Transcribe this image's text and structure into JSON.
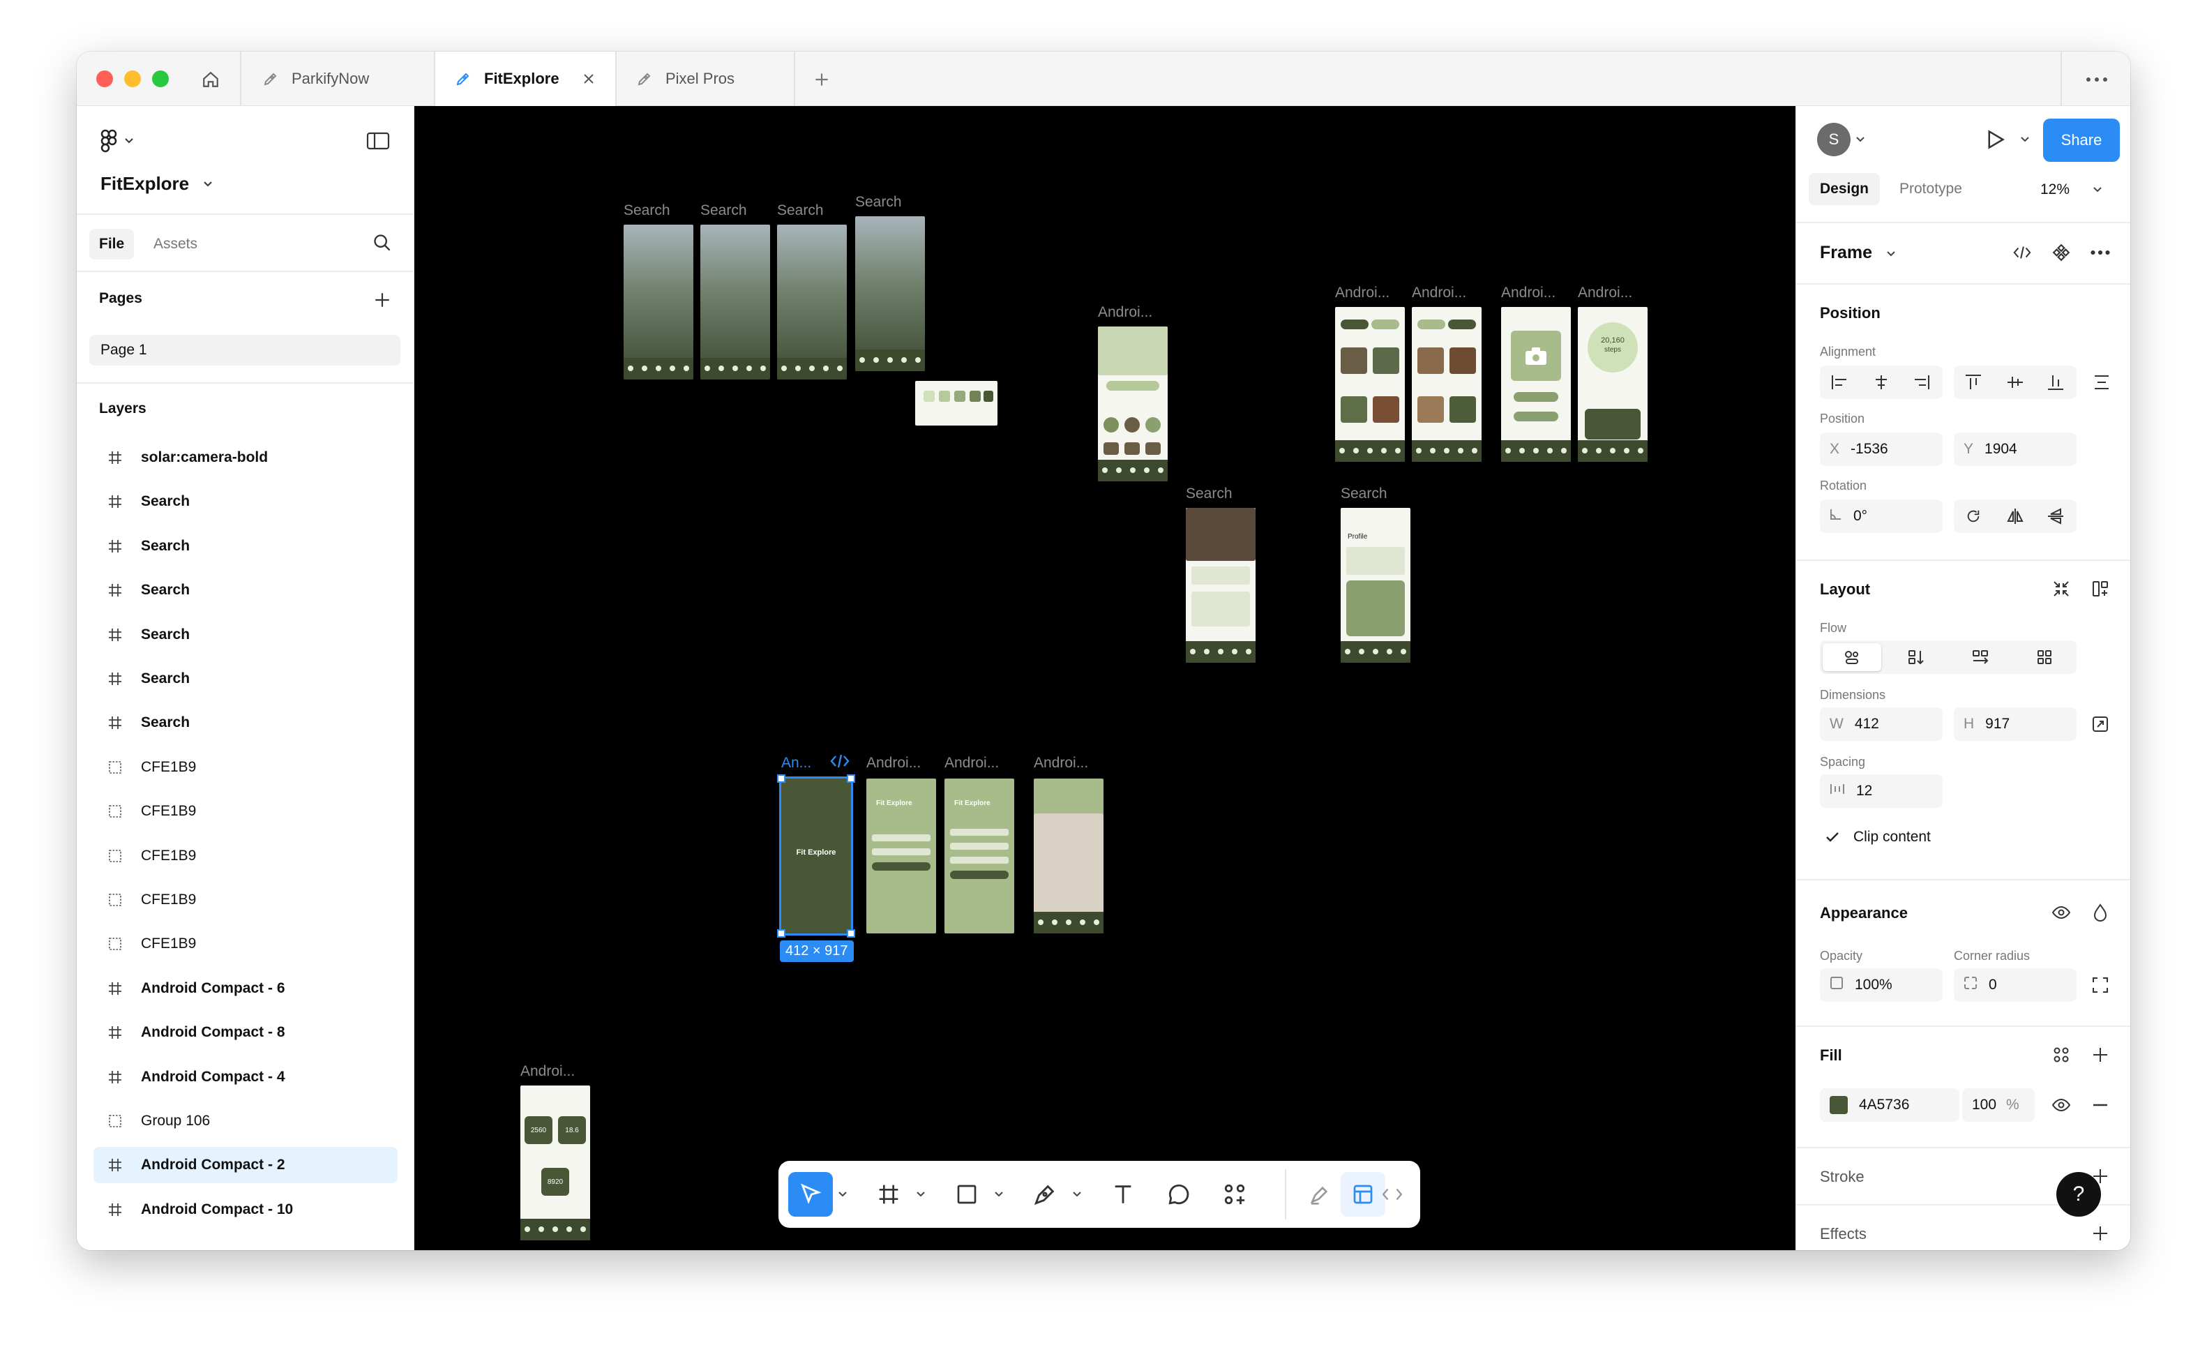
{
  "tabs": [
    {
      "label": "ParkifyNow"
    },
    {
      "label": "FitExplore"
    },
    {
      "label": "Pixel Pros"
    }
  ],
  "file": {
    "name": "FitExplore"
  },
  "left_tabs": {
    "file": "File",
    "assets": "Assets"
  },
  "pages": {
    "title": "Pages",
    "items": [
      "Page 1"
    ]
  },
  "layers": {
    "title": "Layers",
    "items": [
      {
        "label": "solar:camera-bold",
        "icon": "frame-icon"
      },
      {
        "label": "Search",
        "icon": "frame-icon"
      },
      {
        "label": "Search",
        "icon": "frame-icon"
      },
      {
        "label": "Search",
        "icon": "frame-icon"
      },
      {
        "label": "Search",
        "icon": "frame-icon"
      },
      {
        "label": "Search",
        "icon": "frame-icon"
      },
      {
        "label": "Search",
        "icon": "frame-icon"
      },
      {
        "label": "CFE1B9",
        "icon": "group-icon"
      },
      {
        "label": "CFE1B9",
        "icon": "group-icon"
      },
      {
        "label": "CFE1B9",
        "icon": "group-icon"
      },
      {
        "label": "CFE1B9",
        "icon": "group-icon"
      },
      {
        "label": "CFE1B9",
        "icon": "group-icon"
      },
      {
        "label": "Android Compact - 6",
        "icon": "frame-icon"
      },
      {
        "label": "Android Compact - 8",
        "icon": "frame-icon"
      },
      {
        "label": "Android Compact - 4",
        "icon": "frame-icon"
      },
      {
        "label": "Group 106",
        "icon": "group-icon"
      },
      {
        "label": "Android Compact - 2",
        "icon": "frame-icon",
        "selected": true
      },
      {
        "label": "Android Compact - 10",
        "icon": "frame-icon"
      }
    ]
  },
  "canvas": {
    "frame_labels": [
      "Search",
      "Search",
      "Search",
      "Search",
      "Androi...",
      "Androi...",
      "Androi...",
      "Androi...",
      "Androi...",
      "Search",
      "Search",
      "An...",
      "Androi...",
      "Androi...",
      "Androi...",
      "Androi..."
    ],
    "selection_size": "412 × 917",
    "mock_text": {
      "fit_explore": "Fit Explore",
      "steps": "20,160",
      "steps_unit": "steps",
      "profile": "Profile",
      "stat_a": "2560",
      "stat_b": "18.6",
      "stat_c": "8920"
    }
  },
  "right": {
    "avatar_initial": "S",
    "share_label": "Share",
    "tab_design": "Design",
    "tab_prototype": "Prototype",
    "zoom": "12%",
    "frame_title": "Frame",
    "position": {
      "title": "Position",
      "alignment_label": "Alignment",
      "position_label": "Position",
      "x_prefix": "X",
      "x_value": "-1536",
      "y_prefix": "Y",
      "y_value": "1904",
      "rotation_label": "Rotation",
      "rotation_value": "0°"
    },
    "layout": {
      "title": "Layout",
      "flow_label": "Flow",
      "dimensions_label": "Dimensions",
      "w_prefix": "W",
      "w_value": "412",
      "h_prefix": "H",
      "h_value": "917",
      "spacing_label": "Spacing",
      "spacing_value": "12",
      "clip_label": "Clip content"
    },
    "appearance": {
      "title": "Appearance",
      "opacity_label": "Opacity",
      "opacity_value": "100%",
      "radius_label": "Corner radius",
      "radius_value": "0"
    },
    "fill": {
      "title": "Fill",
      "hex": "4A5736",
      "opacity": "100",
      "unit": "%",
      "color": "#4a5736"
    },
    "stroke": {
      "title": "Stroke"
    },
    "effects": {
      "title": "Effects"
    }
  },
  "help_label": "?",
  "colors": {
    "accent": "#2b8cf5",
    "brand_green": "#4a5736"
  }
}
